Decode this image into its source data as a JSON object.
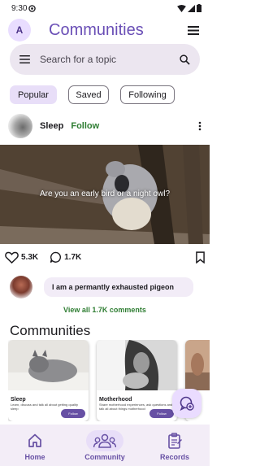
{
  "status_bar": {
    "time": "9:30"
  },
  "app_bar": {
    "avatar_letter": "A",
    "title": "Communities"
  },
  "search": {
    "placeholder": "Search for a topic"
  },
  "filters": [
    {
      "label": "Popular",
      "selected": true
    },
    {
      "label": "Saved",
      "selected": false
    },
    {
      "label": "Following",
      "selected": false
    }
  ],
  "post": {
    "author": "Sleep",
    "follow_label": "Follow",
    "caption": "Are you an early bird or a night owl?",
    "likes": "5.3K",
    "comments_count": "1.7K",
    "top_comment": "I am a permantly exhausted pigeon",
    "view_all": "View all 1.7K comments"
  },
  "communities_section": {
    "title": "Communities",
    "cards": [
      {
        "name": "Sleep",
        "description": "Learn, discuss and talk all about getting quality sleep",
        "follow_label": "Follow"
      },
      {
        "name": "Motherhood",
        "description": "Share motherhood experiences, ask questions and talk all about things motherhood",
        "follow_label": "Follow"
      },
      {
        "name": "",
        "description": "",
        "follow_label": ""
      }
    ]
  },
  "bottom_nav": [
    {
      "label": "Home",
      "icon": "home-icon",
      "active": false
    },
    {
      "label": "Community",
      "icon": "groups-icon",
      "active": true
    },
    {
      "label": "Records",
      "icon": "clipboard-icon",
      "active": false
    }
  ],
  "colors": {
    "accent": "#6750a4",
    "follow": "#2e7d32",
    "chip_selected": "#e8def8",
    "title": "#6a4fb6"
  }
}
